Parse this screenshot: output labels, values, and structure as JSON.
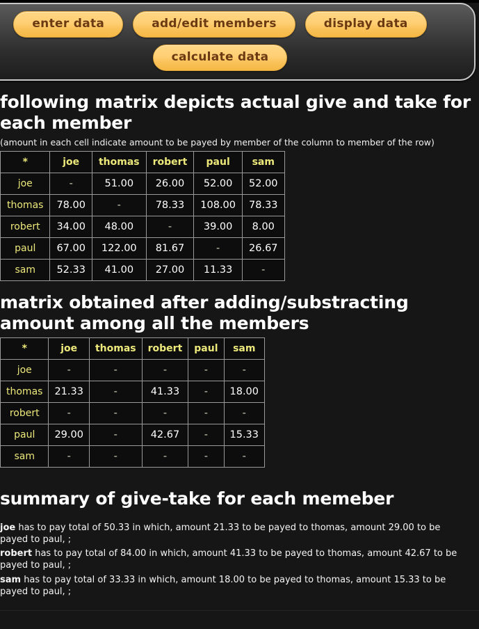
{
  "nav": {
    "rows": [
      [
        {
          "label": "enter data",
          "name": "enter-data-button"
        },
        {
          "label": "add/edit members",
          "name": "add-edit-members-button"
        },
        {
          "label": "display data",
          "name": "display-data-button"
        }
      ],
      [
        {
          "label": "calculate data",
          "name": "calculate-data-button"
        }
      ]
    ]
  },
  "colors": {
    "background": "#161616",
    "button_face": "#ffcf73",
    "button_text": "#6b3a12",
    "header_label": "#ece87a",
    "value_text": "#ffffff",
    "table_border": "#9a9a9a"
  },
  "actual": {
    "title": "following matrix depicts actual give and take for each member",
    "subtitle": "(amount in each cell indicate amount to be payed by member of the column to member of the row)",
    "columns": [
      "*",
      "joe",
      "thomas",
      "robert",
      "paul",
      "sam"
    ],
    "rows": [
      {
        "label": "joe",
        "cells": [
          "-",
          "51.00",
          "26.00",
          "52.00",
          "52.00"
        ]
      },
      {
        "label": "thomas",
        "cells": [
          "78.00",
          "-",
          "78.33",
          "108.00",
          "78.33"
        ]
      },
      {
        "label": "robert",
        "cells": [
          "34.00",
          "48.00",
          "-",
          "39.00",
          "8.00"
        ]
      },
      {
        "label": "paul",
        "cells": [
          "67.00",
          "122.00",
          "81.67",
          "-",
          "26.67"
        ]
      },
      {
        "label": "sam",
        "cells": [
          "52.33",
          "41.00",
          "27.00",
          "11.33",
          "-"
        ]
      }
    ]
  },
  "settled": {
    "title": "matrix obtained after adding/substracting amount among all the members",
    "columns": [
      "*",
      "joe",
      "thomas",
      "robert",
      "paul",
      "sam"
    ],
    "rows": [
      {
        "label": "joe",
        "cells": [
          "-",
          "-",
          "-",
          "-",
          "-"
        ]
      },
      {
        "label": "thomas",
        "cells": [
          "21.33",
          "-",
          "41.33",
          "-",
          "18.00"
        ]
      },
      {
        "label": "robert",
        "cells": [
          "-",
          "-",
          "-",
          "-",
          "-"
        ]
      },
      {
        "label": "paul",
        "cells": [
          "29.00",
          "-",
          "42.67",
          "-",
          "15.33"
        ]
      },
      {
        "label": "sam",
        "cells": [
          "-",
          "-",
          "-",
          "-",
          "-"
        ]
      }
    ]
  },
  "summary": {
    "title": "summary of give-take for each memeber",
    "lines": [
      {
        "member": "joe",
        "text": " has to pay total of 50.33 in which, amount 21.33 to be payed to thomas, amount 29.00 to be payed to paul, ;"
      },
      {
        "member": "robert",
        "text": " has to pay total of 84.00 in which, amount 41.33 to be payed to thomas, amount 42.67 to be payed to paul, ;"
      },
      {
        "member": "sam",
        "text": " has to pay total of 33.33 in which, amount 18.00 to be payed to thomas, amount 15.33 to be payed to paul, ;"
      }
    ]
  }
}
